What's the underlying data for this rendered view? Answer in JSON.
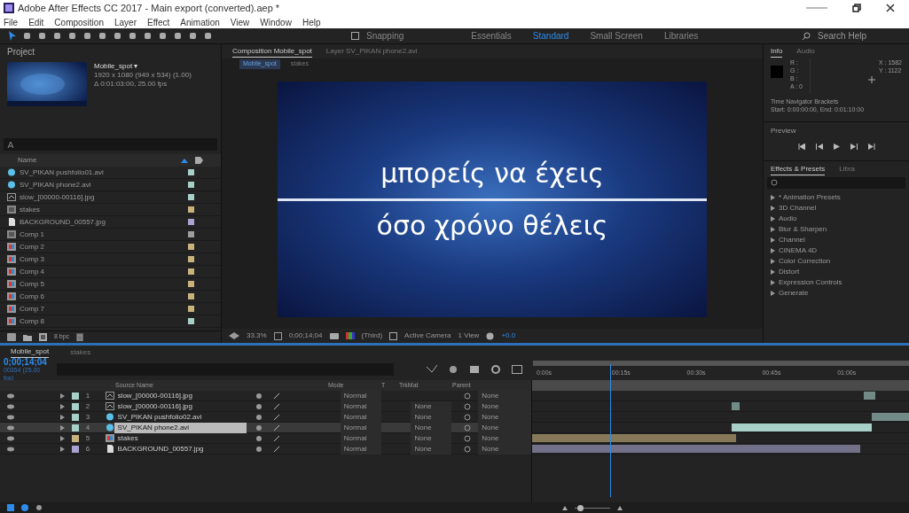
{
  "window": {
    "title": "Adobe After Effects CC 2017 - Main export (converted).aep *"
  },
  "menu": [
    "File",
    "Edit",
    "Composition",
    "Layer",
    "Effect",
    "Animation",
    "View",
    "Window",
    "Help"
  ],
  "toolbar": {
    "snapping": "Snapping",
    "snapping_checked": false,
    "workspaces": [
      {
        "label": "Essentials",
        "selected": false
      },
      {
        "label": "Standard",
        "selected": true
      },
      {
        "label": "Small Screen",
        "selected": false
      },
      {
        "label": "Libraries",
        "selected": false
      }
    ],
    "search": "Search Help"
  },
  "project": {
    "title": "Project",
    "comp_name": "Mobile_spot ▾",
    "comp_size": "1920 x 1080  (949 x 534) (1.00)",
    "comp_duration": "Δ 0:01:03:00, 25.00 fps",
    "column_name": "Name",
    "items": [
      {
        "kind": "footage",
        "name": "SV_PIKAN pushfolio01.avi",
        "color": "#a7d0c8"
      },
      {
        "kind": "footage",
        "name": "SV_PIKAN phone2.avi",
        "color": "#a7d0c8"
      },
      {
        "kind": "sequence",
        "name": "slow_[00000-00116].jpg",
        "color": "#a7d0c8"
      },
      {
        "kind": "folder",
        "name": "stakes",
        "color": "#c9b27c"
      },
      {
        "kind": "file",
        "name": "BACKGROUND_00557.jpg",
        "color": "#a9a3cf"
      },
      {
        "kind": "folder",
        "name": "Comp 1",
        "color": "#9e9e9e"
      },
      {
        "kind": "comp",
        "name": "Comp 2",
        "color": "#c9b27c"
      },
      {
        "kind": "comp",
        "name": "Comp 3",
        "color": "#c9b27c"
      },
      {
        "kind": "comp",
        "name": "Comp 4",
        "color": "#c9b27c"
      },
      {
        "kind": "comp",
        "name": "Comp 5",
        "color": "#c9b27c"
      },
      {
        "kind": "comp",
        "name": "Comp 6",
        "color": "#c9b27c"
      },
      {
        "kind": "comp",
        "name": "Comp 7",
        "color": "#c9b27c"
      },
      {
        "kind": "comp",
        "name": "Comp 8",
        "color": "#a7d0c8"
      }
    ],
    "bpc": "8 bpc"
  },
  "viewer": {
    "tabs": [
      {
        "label": "Composition Mobile_spot",
        "selected": true
      },
      {
        "label": "Layer SV_PIKAN phone2.avi",
        "selected": false
      }
    ],
    "breadcrumbs": [
      "Mobile_spot",
      "stakes"
    ],
    "lines": [
      "μπορείς να έχεις",
      "όσο χρόνο θέλεις"
    ],
    "zoom": "33.3%",
    "time": "0;00;14;04",
    "resolution": "(Third)",
    "camera": "Active Camera",
    "views": "1 View",
    "exposure": "+0.0"
  },
  "info": {
    "tabs": [
      {
        "label": "Info",
        "selected": true
      },
      {
        "label": "Audio",
        "selected": false
      }
    ],
    "channels": [
      "R :",
      "G :",
      "B :",
      "A : 0"
    ],
    "coords": [
      "X : 1582",
      "Y : 1122"
    ],
    "note": "Time Navigator Brackets",
    "range": "Start: 0:00:00:00, End: 0:01:10:00"
  },
  "preview": {
    "title": "Preview"
  },
  "effects": {
    "tabs": [
      {
        "label": "Effects & Presets",
        "selected": true
      },
      {
        "label": "Libra",
        "selected": false
      }
    ],
    "items": [
      "* Animation Presets",
      "3D Channel",
      "Audio",
      "Blur & Sharpen",
      "Channel",
      "CINEMA 4D",
      "Color Correction",
      "Distort",
      "Expression Controls",
      "Generate"
    ]
  },
  "timeline": {
    "tabs": [
      {
        "label": "Mobile_spot",
        "selected": true
      },
      {
        "label": "stakes",
        "selected": false
      }
    ],
    "time": "0;00;14;04",
    "frames": "00354 (25.00 fps)",
    "columns": {
      "source": "Source Name",
      "mode": "Mode",
      "t": "T",
      "trkmat": "TrkMat",
      "parent": "Parent"
    },
    "zoom": {
      "level": 0.1
    },
    "ruler": [
      "0:00s",
      "00:15s",
      "00:30s",
      "00:45s",
      "01:00s"
    ],
    "layers": [
      {
        "number": "1",
        "kind": "sequence",
        "name": "slow_[00000-00116].jpg",
        "color": "#a7d0c8",
        "mode": "Normal",
        "parent": "None",
        "selected": false
      },
      {
        "number": "2",
        "kind": "sequence",
        "name": "slow_[00000-00116].jpg",
        "color": "#a7d0c8",
        "mode": "Normal",
        "trkmat": "None",
        "parent": "None",
        "selected": false
      },
      {
        "number": "3",
        "kind": "footage",
        "name": "SV_PIKAN pushfolio02.avi",
        "color": "#a7d0c8",
        "mode": "Normal",
        "trkmat": "None",
        "parent": "None",
        "selected": false
      },
      {
        "number": "4",
        "kind": "footage",
        "name": "SV_PIKAN phone2.avi",
        "color": "#a7d0c8",
        "mode": "Normal",
        "trkmat": "None",
        "parent": "None",
        "selected": true
      },
      {
        "number": "5",
        "kind": "comp",
        "name": "stakes",
        "color": "#c9b27c",
        "mode": "Normal",
        "trkmat": "None",
        "parent": "None",
        "selected": false
      },
      {
        "number": "6",
        "kind": "file",
        "name": "BACKGROUND_00557.jpg",
        "color": "#a9a3cf",
        "mode": "Normal",
        "trkmat": "None",
        "parent": "None",
        "selected": false
      }
    ]
  }
}
